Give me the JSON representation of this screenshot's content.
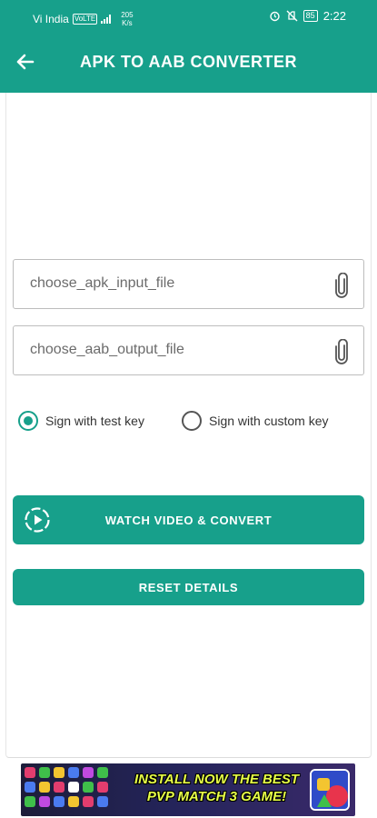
{
  "status_bar": {
    "carrier": "Vi India",
    "volte_badge": "VoLTE",
    "network_speed": "205",
    "network_speed_unit": "K/s",
    "battery_level": "85",
    "time": "2:22"
  },
  "app_bar": {
    "title": "APK TO AAB CONVERTER"
  },
  "form": {
    "input_file": {
      "placeholder": "choose_apk_input_file"
    },
    "output_file": {
      "placeholder": "choose_aab_output_file"
    },
    "signing": {
      "options": [
        {
          "label": "Sign with test key",
          "selected": true
        },
        {
          "label": "Sign with custom key",
          "selected": false
        }
      ]
    },
    "convert_button": "WATCH VIDEO & CONVERT",
    "reset_button": "RESET DETAILS"
  },
  "ad": {
    "text_line1": "INSTALL NOW THE BEST",
    "text_line2": "PVP MATCH 3 GAME!"
  },
  "colors": {
    "primary": "#17a08b",
    "ad_text": "#e7ff47"
  }
}
